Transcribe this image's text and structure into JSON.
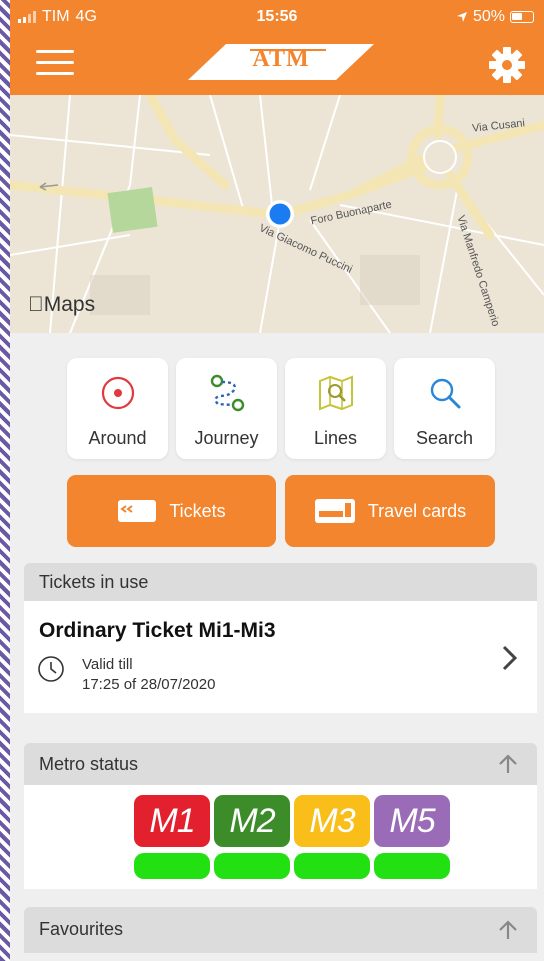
{
  "status_bar": {
    "carrier": "TIM",
    "network": "4G",
    "time": "15:56",
    "battery": "50%"
  },
  "header": {
    "logo_text": "ATM",
    "menu_icon": "hamburger-icon",
    "settings_icon": "gear-icon"
  },
  "map": {
    "streets": [
      "Via Cusani",
      "Foro Buonaparte",
      "Via Giacomo Puccini",
      "Via Manfredo Camperio"
    ],
    "brand": "Maps"
  },
  "actions": [
    {
      "label": "Around",
      "icon": "location-target-icon"
    },
    {
      "label": "Journey",
      "icon": "route-icon"
    },
    {
      "label": "Lines",
      "icon": "map-lines-icon"
    },
    {
      "label": "Search",
      "icon": "search-icon"
    }
  ],
  "buttons": {
    "tickets": "Tickets",
    "travel_cards": "Travel cards"
  },
  "tickets_in_use": {
    "title": "Tickets in use",
    "ticket_name": "Ordinary Ticket Mi1-Mi3",
    "valid_label": "Valid till",
    "valid_until": "17:25 of 28/07/2020"
  },
  "metro_status": {
    "title": "Metro status",
    "lines": [
      {
        "label": "M1",
        "color": "#e2202e",
        "status_color": "#22e012"
      },
      {
        "label": "M2",
        "color": "#3c8d2a",
        "status_color": "#22e012"
      },
      {
        "label": "M3",
        "color": "#f9be19",
        "status_color": "#22e012"
      },
      {
        "label": "M5",
        "color": "#9a6cb8",
        "status_color": "#22e012"
      }
    ]
  },
  "favourites": {
    "title": "Favourites"
  },
  "colors": {
    "brand_orange": "#f2852d",
    "location_blue": "#1a7cf0"
  }
}
